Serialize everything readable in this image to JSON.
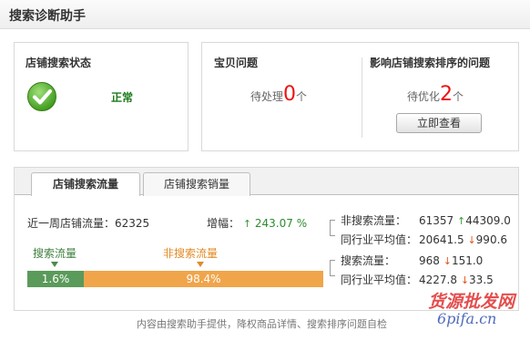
{
  "header": {
    "title": "搜索诊断助手"
  },
  "store_status": {
    "title": "店铺搜索状态",
    "value": "正常",
    "icon": "check-circle-icon"
  },
  "item_issues": {
    "title": "宝贝问题",
    "prefix": "待处理",
    "count": "0",
    "suffix": "个"
  },
  "ranking_issues": {
    "title": "影响店铺搜索排序的问题",
    "prefix": "待优化",
    "count": "2",
    "suffix": "个",
    "button": "立即查看"
  },
  "tabs": [
    {
      "label": "店铺搜索流量",
      "active": true
    },
    {
      "label": "店铺搜索销量",
      "active": false
    }
  ],
  "traffic": {
    "week_label": "近一周店铺流量：",
    "week_value": "62325",
    "growth_label": "增幅：",
    "growth_arrow": "↑",
    "growth_value": "243.07 %",
    "search_label": "搜索流量",
    "nonsearch_label": "非搜索流量",
    "search_share": 0.016,
    "search_pct": "1.6%",
    "nonsearch_pct": "98.4%",
    "colors": {
      "search": "#5a9a5a",
      "nonsearch": "#f0a54b"
    }
  },
  "metrics": [
    {
      "label": "非搜索流量：",
      "value": "61357",
      "arrow": "↑",
      "dir": "up",
      "change": "44309.0"
    },
    {
      "label": "同行业平均值：",
      "value": "20641.5",
      "arrow": "↓",
      "dir": "down",
      "change": "990.6"
    },
    {
      "label": "搜索流量：",
      "value": "968",
      "arrow": "↓",
      "dir": "down",
      "change": "151.0"
    },
    {
      "label": "同行业平均值：",
      "value": "4227.8",
      "arrow": "↓",
      "dir": "down",
      "change": "33.5"
    }
  ],
  "footer": {
    "text": "内容由搜索助手提供，降权商品详情、搜索排序问题自检"
  },
  "watermark": {
    "line1": "货源批发网",
    "line2": "6pifa.cn"
  }
}
